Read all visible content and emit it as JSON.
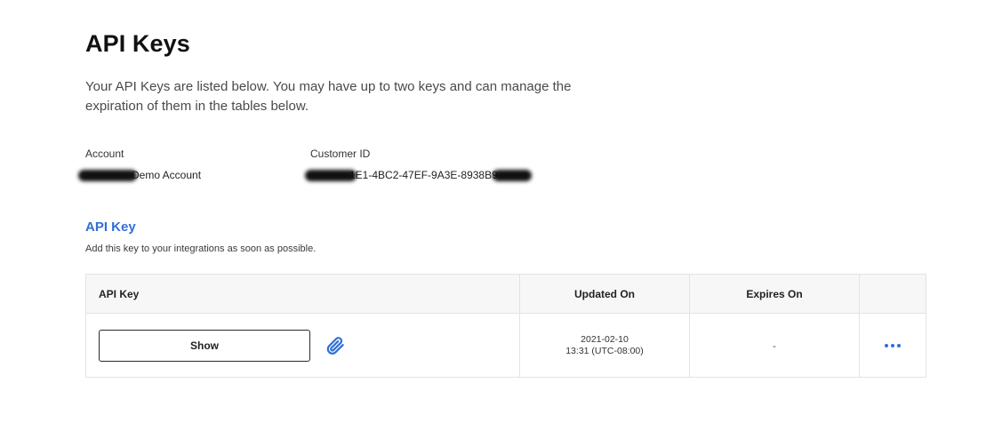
{
  "header": {
    "title": "API Keys",
    "description": "Your API Keys are listed below. You may have up to two keys and can manage the expiration of them in the tables below."
  },
  "account": {
    "label": "Account",
    "value_visible": "Demo Account"
  },
  "customer": {
    "label": "Customer ID",
    "value_visible": "1E1-4BC2-47EF-9A3E-8938B9"
  },
  "section": {
    "title": "API Key",
    "subtitle": "Add this key to your integrations as soon as possible."
  },
  "table": {
    "columns": [
      "API Key",
      "Updated On",
      "Expires On",
      ""
    ],
    "rows": [
      {
        "show_label": "Show",
        "updated_date": "2021-02-10",
        "updated_time": "13:31 (UTC-08:00)",
        "expires": "-"
      }
    ]
  },
  "icons": {
    "copy": "paperclip-icon",
    "more": "more-horizontal-icon"
  },
  "colors": {
    "accent": "#2f6fd6",
    "header_bg": "#f7f7f8",
    "border": "#e3e3e3"
  }
}
